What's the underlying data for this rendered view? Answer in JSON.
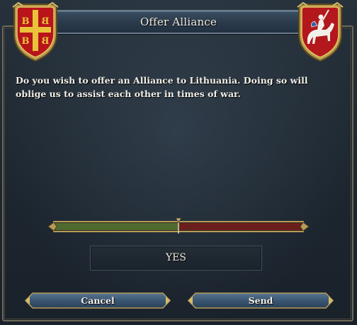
{
  "dialog": {
    "title": "Offer Alliance",
    "message": "Do you wish to offer an Alliance to Lithuania. Doing so will oblige us to assist each other in times of war.",
    "acceptance": {
      "verdict": "YES",
      "marker_fraction": 0.5,
      "positive_color": "#4f6a2e",
      "negative_color": "#6b1f1c"
    },
    "buttons": {
      "cancel": "Cancel",
      "send": "Send"
    },
    "shields": {
      "left": "byzantine-cross-coat-of-arms-icon",
      "right": "lithuania-vytis-coat-of-arms-icon"
    }
  }
}
